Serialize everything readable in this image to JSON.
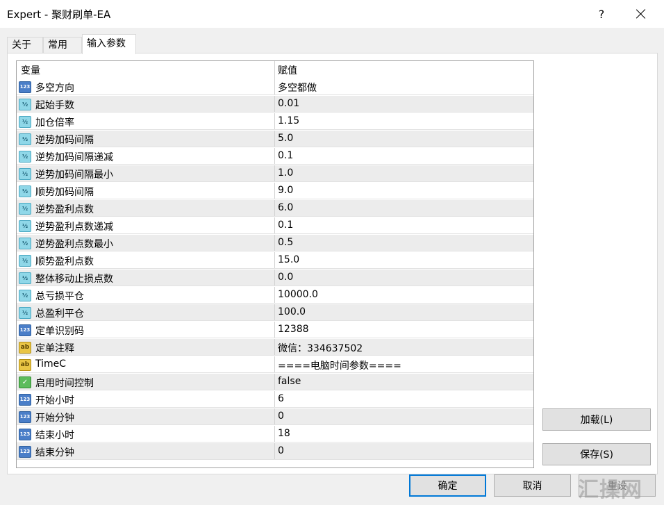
{
  "window": {
    "title": "Expert - 聚财刷单-EA",
    "help_label": "?"
  },
  "tabs": [
    {
      "label": "关于"
    },
    {
      "label": "常用"
    },
    {
      "label": "输入参数"
    }
  ],
  "grid": {
    "headers": {
      "name": "变量",
      "value": "赋值"
    },
    "rows": [
      {
        "type_icon": "int-icon",
        "name": "多空方向",
        "value": "多空都做"
      },
      {
        "type_icon": "double-icon",
        "name": "起始手数",
        "value": "0.01"
      },
      {
        "type_icon": "double-icon",
        "name": "加仓倍率",
        "value": "1.15"
      },
      {
        "type_icon": "double-icon",
        "name": "逆势加码间隔",
        "value": "5.0"
      },
      {
        "type_icon": "double-icon",
        "name": "逆势加码间隔递减",
        "value": "0.1"
      },
      {
        "type_icon": "double-icon",
        "name": "逆势加码间隔最小",
        "value": "1.0"
      },
      {
        "type_icon": "double-icon",
        "name": "顺势加码间隔",
        "value": "9.0"
      },
      {
        "type_icon": "double-icon",
        "name": "逆势盈利点数",
        "value": "6.0"
      },
      {
        "type_icon": "double-icon",
        "name": "逆势盈利点数递减",
        "value": "0.1"
      },
      {
        "type_icon": "double-icon",
        "name": "逆势盈利点数最小",
        "value": "0.5"
      },
      {
        "type_icon": "double-icon",
        "name": "顺势盈利点数",
        "value": "15.0"
      },
      {
        "type_icon": "double-icon",
        "name": "整体移动止损点数",
        "value": "0.0"
      },
      {
        "type_icon": "double-icon",
        "name": "总亏损平仓",
        "value": "10000.0"
      },
      {
        "type_icon": "double-icon",
        "name": "总盈利平仓",
        "value": "100.0"
      },
      {
        "type_icon": "int-icon",
        "name": "定单识别码",
        "value": "12388"
      },
      {
        "type_icon": "string-icon",
        "name": "定单注释",
        "value": "微信：334637502"
      },
      {
        "type_icon": "string-icon",
        "name": "TimeC",
        "value": "====电脑时间参数===="
      },
      {
        "type_icon": "bool-icon",
        "name": "启用时间控制",
        "value": "false"
      },
      {
        "type_icon": "int-icon",
        "name": "开始小时",
        "value": "6"
      },
      {
        "type_icon": "int-icon",
        "name": "开始分钟",
        "value": "0"
      },
      {
        "type_icon": "int-icon",
        "name": "结束小时",
        "value": "18"
      },
      {
        "type_icon": "int-icon",
        "name": "结束分钟",
        "value": "0"
      }
    ]
  },
  "icon_glyphs": {
    "int": "123",
    "double": "½",
    "string": "ab",
    "bool": "✓"
  },
  "buttons": {
    "load": "加载(L)",
    "save": "保存(S)",
    "ok": "确定",
    "cancel": "取消",
    "reset": "重设"
  },
  "watermark": "汇操网",
  "colors": {
    "accent": "#0078d7",
    "alt_row": "#ececec"
  }
}
